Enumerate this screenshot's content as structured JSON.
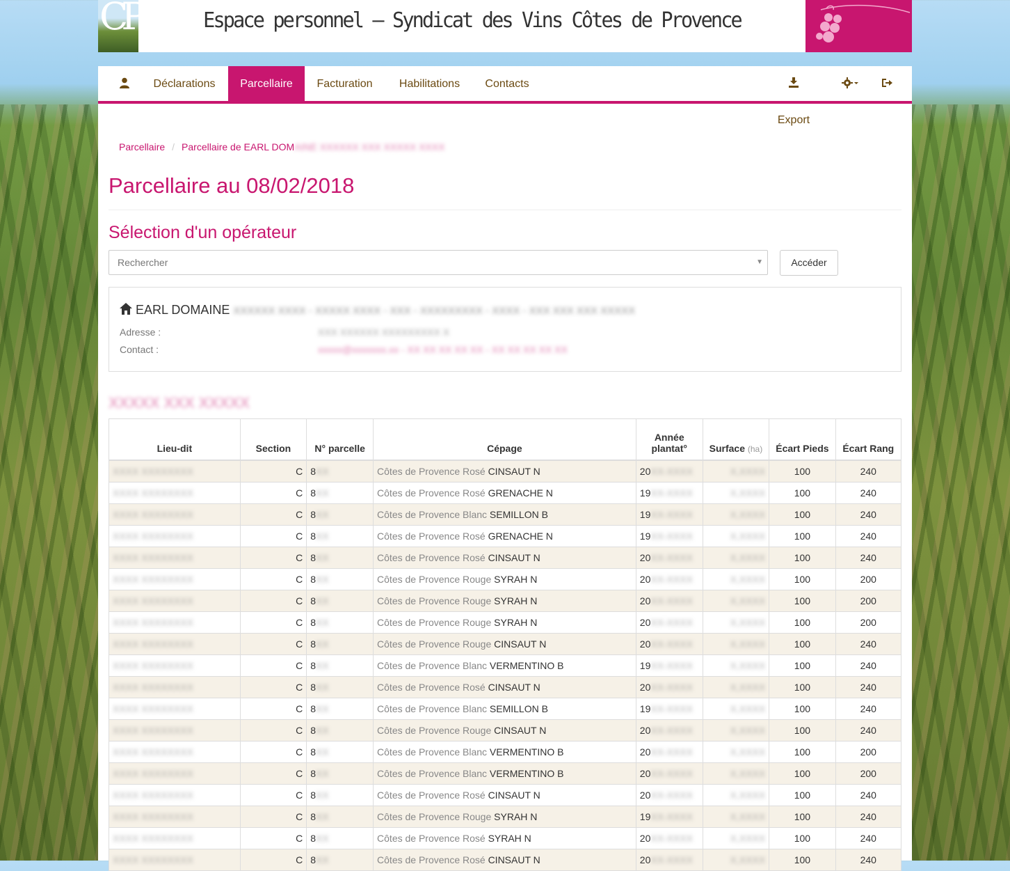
{
  "header": {
    "logo_text": "CP",
    "title": "Espace personnel – Syndicat des Vins Côtes de Provence"
  },
  "colors": {
    "brand": "#c8166f",
    "nav_text": "#6b4a12",
    "row_alt": "#f6f1e7"
  },
  "nav": {
    "user_icon": "user-icon",
    "items": [
      "Déclarations",
      "Parcellaire",
      "Facturation",
      "Habilitations",
      "Contacts"
    ],
    "active": "Parcellaire",
    "export_label": "Export",
    "export_icon": "export-icon",
    "settings_icon": "gear-icon",
    "logout_icon": "logout-icon"
  },
  "breadcrumb": {
    "root": "Parcellaire",
    "current": "Parcellaire de EARL DOM",
    "current_hidden": "AINE XXXXXX XXX XXXXX XXXX"
  },
  "page_title": "Parcellaire au 08/02/2018",
  "operator_section": {
    "title": "Sélection d'un opérateur",
    "search_placeholder": "Rechercher",
    "access_button": "Accéder"
  },
  "operator": {
    "name": "EARL DOMAINE",
    "name_hidden": "XXXXXX XXXX - XXXXX XXXX - XXX - XXXXXXXXX - XXXX - XXX XXX XXX XXXXX",
    "address_label": "Adresse :",
    "address_hidden": "XXX XXXXXX XXXXXXXXX X",
    "contact_label": "Contact :",
    "contact_hidden": "xxxxx@xxxxxxx.xx - XX XX XX XX XX - XX XX XX XX XX"
  },
  "commune_hidden": "XXXXX XXX XXXXX",
  "table": {
    "headers": {
      "lieu": "Lieu-dit",
      "section": "Section",
      "num": "N° parcelle",
      "cepage": "Cépage",
      "annee": "Année plantat°",
      "surface": "Surface",
      "surface_unit": "(ha)",
      "ecart_pieds": "Écart Pieds",
      "ecart_rang": "Écart Rang"
    },
    "rows": [
      {
        "section": "C",
        "num": "8",
        "app": "Côtes de Provence Rosé",
        "cep": "CINSAUT N",
        "year": "20",
        "ep": "100",
        "er": "240"
      },
      {
        "section": "C",
        "num": "8",
        "app": "Côtes de Provence Rosé",
        "cep": "GRENACHE N",
        "year": "19",
        "ep": "100",
        "er": "240"
      },
      {
        "section": "C",
        "num": "8",
        "app": "Côtes de Provence Blanc",
        "cep": "SEMILLON B",
        "year": "19",
        "ep": "100",
        "er": "240"
      },
      {
        "section": "C",
        "num": "8",
        "app": "Côtes de Provence Rosé",
        "cep": "GRENACHE N",
        "year": "19",
        "ep": "100",
        "er": "240"
      },
      {
        "section": "C",
        "num": "8",
        "app": "Côtes de Provence Rosé",
        "cep": "CINSAUT N",
        "year": "20",
        "ep": "100",
        "er": "240"
      },
      {
        "section": "C",
        "num": "8",
        "app": "Côtes de Provence Rouge",
        "cep": "SYRAH N",
        "year": "20",
        "ep": "100",
        "er": "200"
      },
      {
        "section": "C",
        "num": "8",
        "app": "Côtes de Provence Rouge",
        "cep": "SYRAH N",
        "year": "20",
        "ep": "100",
        "er": "200"
      },
      {
        "section": "C",
        "num": "8",
        "app": "Côtes de Provence Rouge",
        "cep": "SYRAH N",
        "year": "20",
        "ep": "100",
        "er": "200"
      },
      {
        "section": "C",
        "num": "8",
        "app": "Côtes de Provence Rouge",
        "cep": "CINSAUT N",
        "year": "20",
        "ep": "100",
        "er": "240"
      },
      {
        "section": "C",
        "num": "8",
        "app": "Côtes de Provence Blanc",
        "cep": "VERMENTINO B",
        "year": "19",
        "ep": "100",
        "er": "240"
      },
      {
        "section": "C",
        "num": "8",
        "app": "Côtes de Provence Rosé",
        "cep": "CINSAUT N",
        "year": "20",
        "ep": "100",
        "er": "240"
      },
      {
        "section": "C",
        "num": "8",
        "app": "Côtes de Provence Blanc",
        "cep": "SEMILLON B",
        "year": "19",
        "ep": "100",
        "er": "240"
      },
      {
        "section": "C",
        "num": "8",
        "app": "Côtes de Provence Rouge",
        "cep": "CINSAUT N",
        "year": "20",
        "ep": "100",
        "er": "240"
      },
      {
        "section": "C",
        "num": "8",
        "app": "Côtes de Provence Blanc",
        "cep": "VERMENTINO B",
        "year": "20",
        "ep": "100",
        "er": "200"
      },
      {
        "section": "C",
        "num": "8",
        "app": "Côtes de Provence Blanc",
        "cep": "VERMENTINO B",
        "year": "20",
        "ep": "100",
        "er": "200"
      },
      {
        "section": "C",
        "num": "8",
        "app": "Côtes de Provence Rosé",
        "cep": "CINSAUT N",
        "year": "20",
        "ep": "100",
        "er": "240"
      },
      {
        "section": "C",
        "num": "8",
        "app": "Côtes de Provence Rouge",
        "cep": "SYRAH N",
        "year": "19",
        "ep": "100",
        "er": "240"
      },
      {
        "section": "C",
        "num": "8",
        "app": "Côtes de Provence Rosé",
        "cep": "SYRAH N",
        "year": "20",
        "ep": "100",
        "er": "240"
      },
      {
        "section": "C",
        "num": "8",
        "app": "Côtes de Provence Rosé",
        "cep": "CINSAUT N",
        "year": "20",
        "ep": "100",
        "er": "240"
      }
    ]
  }
}
